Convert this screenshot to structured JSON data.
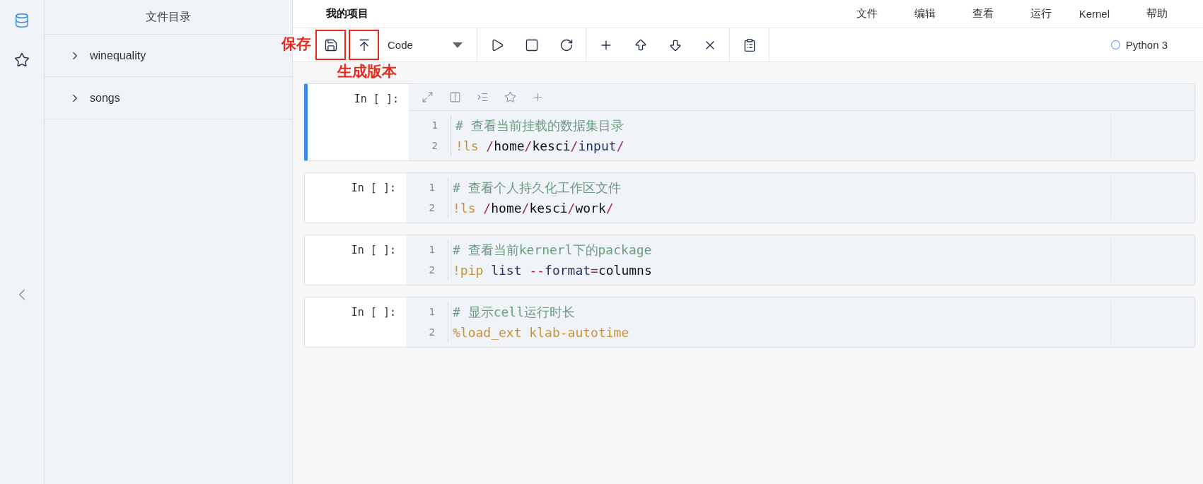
{
  "rail": {
    "items": [
      {
        "kind": "database",
        "selected": true
      },
      {
        "kind": "star",
        "selected": false
      }
    ]
  },
  "sidebar": {
    "title": "文件目录",
    "items": [
      {
        "label": "winequality",
        "expanded": false
      },
      {
        "label": "songs",
        "expanded": false
      }
    ]
  },
  "header": {
    "title": "我的项目",
    "menu": [
      "文件",
      "编辑",
      "查看",
      "运行",
      "Kernel",
      "帮助"
    ]
  },
  "toolbar": {
    "groups": [
      [
        {
          "kind": "save",
          "highlighted": true,
          "annotation": "保存"
        },
        {
          "kind": "publish",
          "highlighted": true,
          "annotation": "生成版本"
        },
        {
          "kind": "select",
          "value": "Code"
        }
      ],
      [
        {
          "kind": "run",
          "highlighted": false
        },
        {
          "kind": "stop",
          "highlighted": false
        },
        {
          "kind": "restart",
          "highlighted": false
        }
      ],
      [
        {
          "kind": "add",
          "highlighted": false
        },
        {
          "kind": "up",
          "highlighted": false
        },
        {
          "kind": "down",
          "highlighted": false
        },
        {
          "kind": "cut",
          "highlighted": false
        }
      ],
      [
        {
          "kind": "clipboard",
          "highlighted": false
        }
      ]
    ],
    "kernel": {
      "name": "Python 3",
      "busy": false
    }
  },
  "cells": [
    {
      "prompt": "In [ ]:",
      "selected": true,
      "lines": [
        {
          "number": "1",
          "tokens": [
            {
              "text": "# 查看当前挂载的数据集目录",
              "kind": "comment"
            }
          ]
        },
        {
          "number": "2",
          "tokens": [
            {
              "text": "!ls ",
              "kind": "magic"
            },
            {
              "text": "/",
              "kind": "operator"
            },
            {
              "text": "home",
              "kind": "plain"
            },
            {
              "text": "/",
              "kind": "operator"
            },
            {
              "text": "kesci",
              "kind": "plain"
            },
            {
              "text": "/",
              "kind": "operator"
            },
            {
              "text": "input",
              "kind": "name"
            },
            {
              "text": "/",
              "kind": "operator"
            }
          ]
        }
      ]
    },
    {
      "prompt": "In [ ]:",
      "selected": false,
      "lines": [
        {
          "number": "1",
          "tokens": [
            {
              "text": "# 查看个人持久化工作区文件",
              "kind": "comment"
            }
          ]
        },
        {
          "number": "2",
          "tokens": [
            {
              "text": "!ls ",
              "kind": "magic"
            },
            {
              "text": "/",
              "kind": "operator"
            },
            {
              "text": "home",
              "kind": "plain"
            },
            {
              "text": "/",
              "kind": "operator"
            },
            {
              "text": "kesci",
              "kind": "plain"
            },
            {
              "text": "/",
              "kind": "operator"
            },
            {
              "text": "work",
              "kind": "plain"
            },
            {
              "text": "/",
              "kind": "operator"
            }
          ]
        }
      ]
    },
    {
      "prompt": "In [ ]:",
      "selected": false,
      "lines": [
        {
          "number": "1",
          "tokens": [
            {
              "text": "# 查看当前kernerl下的package",
              "kind": "comment"
            }
          ]
        },
        {
          "number": "2",
          "tokens": [
            {
              "text": "!pip ",
              "kind": "magic"
            },
            {
              "text": "list ",
              "kind": "name"
            },
            {
              "text": "--",
              "kind": "operator"
            },
            {
              "text": "format",
              "kind": "name"
            },
            {
              "text": "=",
              "kind": "operator"
            },
            {
              "text": "columns",
              "kind": "plain"
            }
          ]
        }
      ]
    },
    {
      "prompt": "In [ ]:",
      "selected": false,
      "lines": [
        {
          "number": "1",
          "tokens": [
            {
              "text": "# 显示cell运行时长",
              "kind": "comment"
            }
          ]
        },
        {
          "number": "2",
          "tokens": [
            {
              "text": "%load_ext klab-autotime",
              "kind": "magic"
            }
          ]
        }
      ]
    }
  ]
}
